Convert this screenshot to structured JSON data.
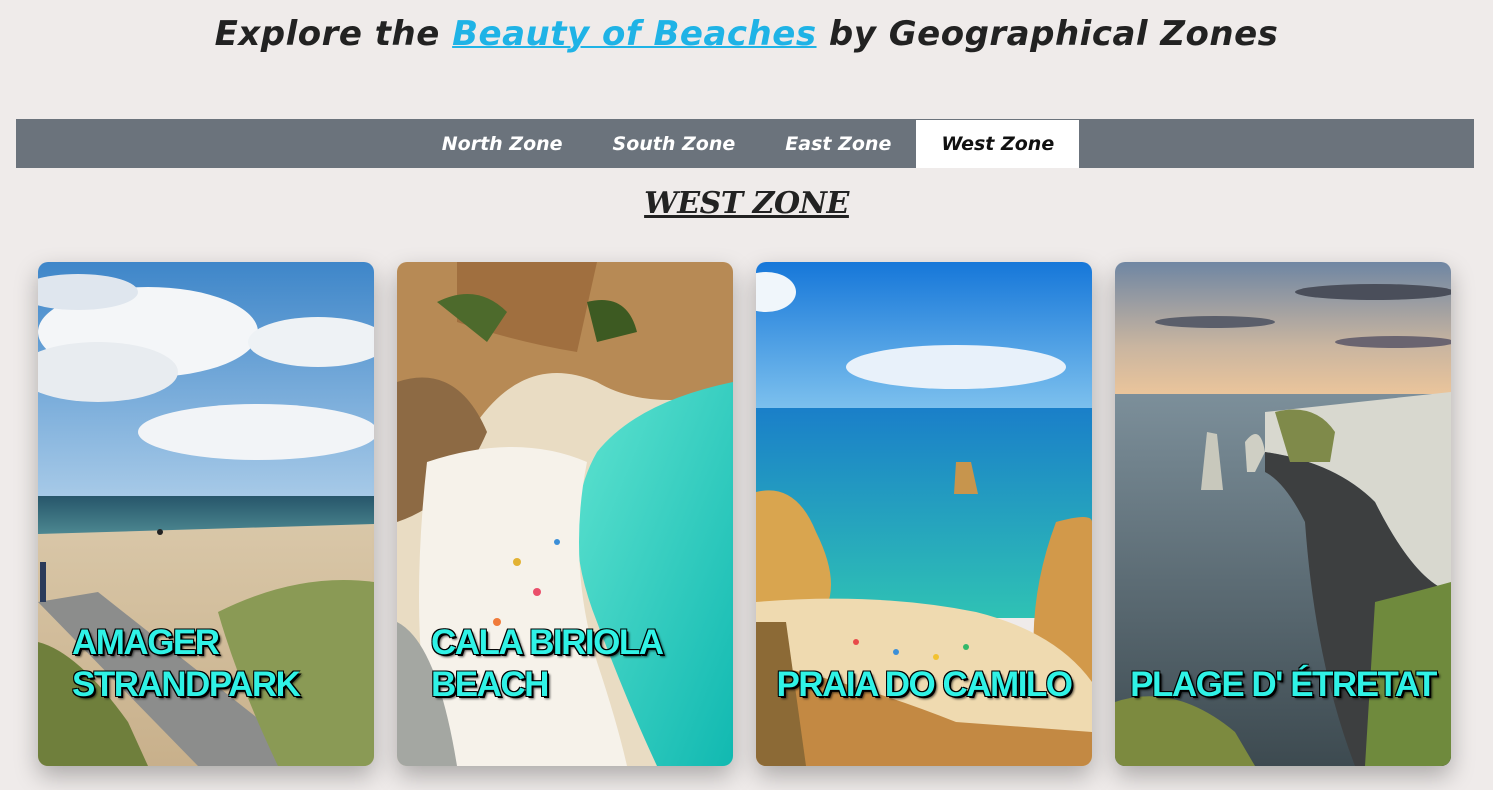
{
  "header": {
    "title_prefix": "Explore the",
    "title_link": "Beauty of Beaches",
    "title_suffix": "by Geographical Zones",
    "link_color": "#1fb3e6"
  },
  "tabs": [
    {
      "label": "North Zone",
      "active": false
    },
    {
      "label": "South Zone",
      "active": false
    },
    {
      "label": "East Zone",
      "active": false
    },
    {
      "label": "West Zone",
      "active": true
    }
  ],
  "section": {
    "heading": "WEST ZONE"
  },
  "cards": [
    {
      "name": "AMAGER STRANDPARK",
      "image": "sandy beach with dunes and cloudy sky"
    },
    {
      "name": "CALA BIRIOLA BEACH",
      "image": "turquoise cove with white sand and cliffs"
    },
    {
      "name": "PRAIA DO CAMILO",
      "image": "golden cliffs and blue sea with beachgoers"
    },
    {
      "name": "PLAGE D' ÉTRETAT",
      "image": "white chalk cliffs and arch at sunset"
    }
  ],
  "colors": {
    "background": "#efebea",
    "tabbar": "#6b737c",
    "card_label": "#2ff2e6"
  }
}
